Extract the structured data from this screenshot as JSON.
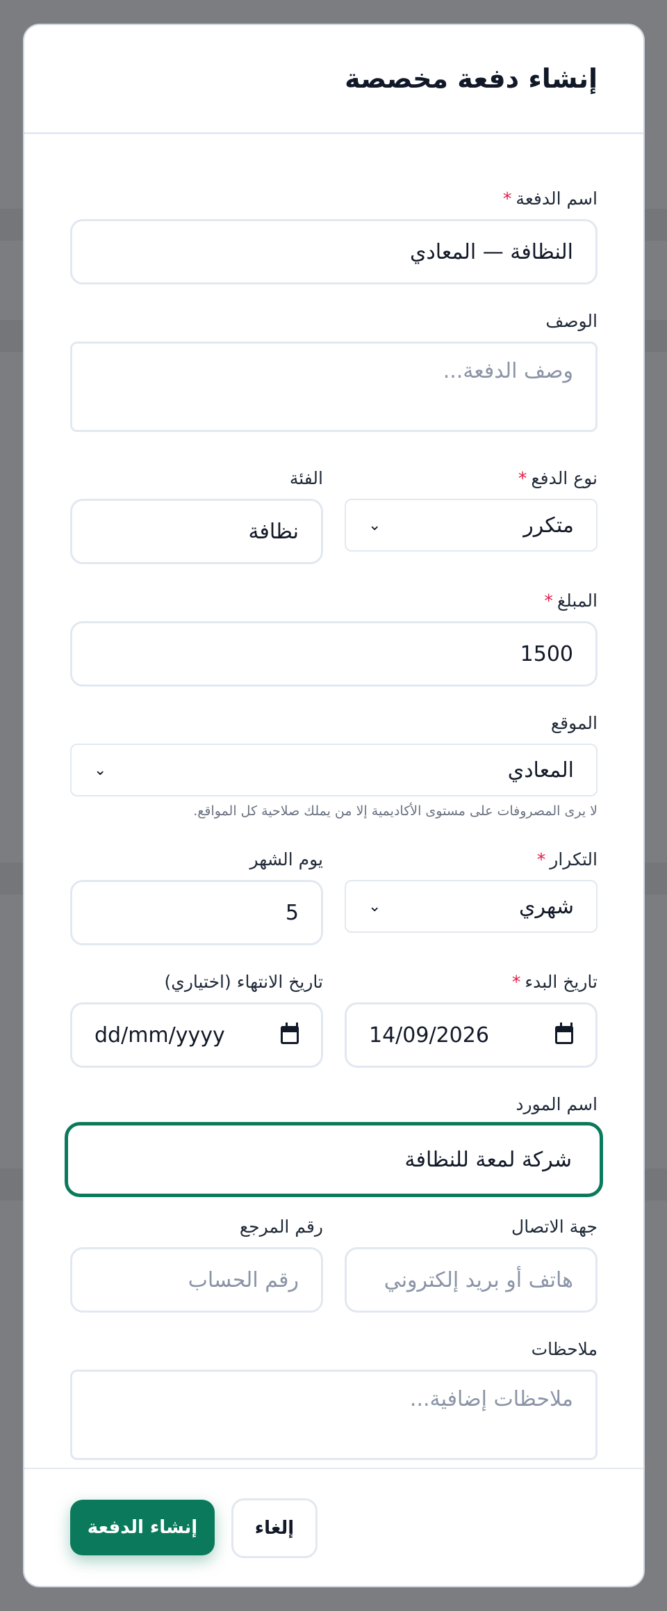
{
  "modal": {
    "title": "إنشاء دفعة مخصصة"
  },
  "fields": {
    "payment_name": {
      "label": "اسم الدفعة",
      "required_mark": "*",
      "value": "النظافة — المعادي"
    },
    "description": {
      "label": "الوصف",
      "placeholder": "وصف الدفعة..."
    },
    "payment_type": {
      "label": "نوع الدفع",
      "required_mark": "*",
      "value": "متكرر"
    },
    "category": {
      "label": "الفئة",
      "value": "نظافة"
    },
    "amount": {
      "label": "المبلغ",
      "required_mark": "*",
      "value": "1500"
    },
    "location": {
      "label": "الموقع",
      "value": "المعادي",
      "hint": "لا يرى المصروفات على مستوى الأكاديمية إلا من يملك صلاحية كل المواقع."
    },
    "recurrence": {
      "label": "التكرار",
      "required_mark": "*",
      "value": "شهري"
    },
    "day_of_month": {
      "label": "يوم الشهر",
      "value": "5"
    },
    "start_date": {
      "label": "تاريخ البدء",
      "required_mark": "*",
      "value": "14/09/2026"
    },
    "end_date": {
      "label": "تاريخ الانتهاء (اختياري)",
      "placeholder": "dd/mm/yyyy"
    },
    "vendor_name": {
      "label": "اسم المورد",
      "value": "شركة لمعة للنظافة"
    },
    "contact": {
      "label": "جهة الاتصال",
      "placeholder": "هاتف أو بريد إلكتروني"
    },
    "reference": {
      "label": "رقم المرجع",
      "placeholder": "رقم الحساب"
    },
    "notes": {
      "label": "ملاحظات",
      "placeholder": "ملاحظات إضافية..."
    }
  },
  "footer": {
    "create_label": "إنشاء الدفعة",
    "cancel_label": "إلغاء"
  },
  "colors": {
    "accent": "#0b7a5c",
    "required": "#e11d48",
    "backdrop": "#7b7d80"
  },
  "icons": {
    "chevron": "chevron-down-icon",
    "calendar": "calendar-icon"
  }
}
